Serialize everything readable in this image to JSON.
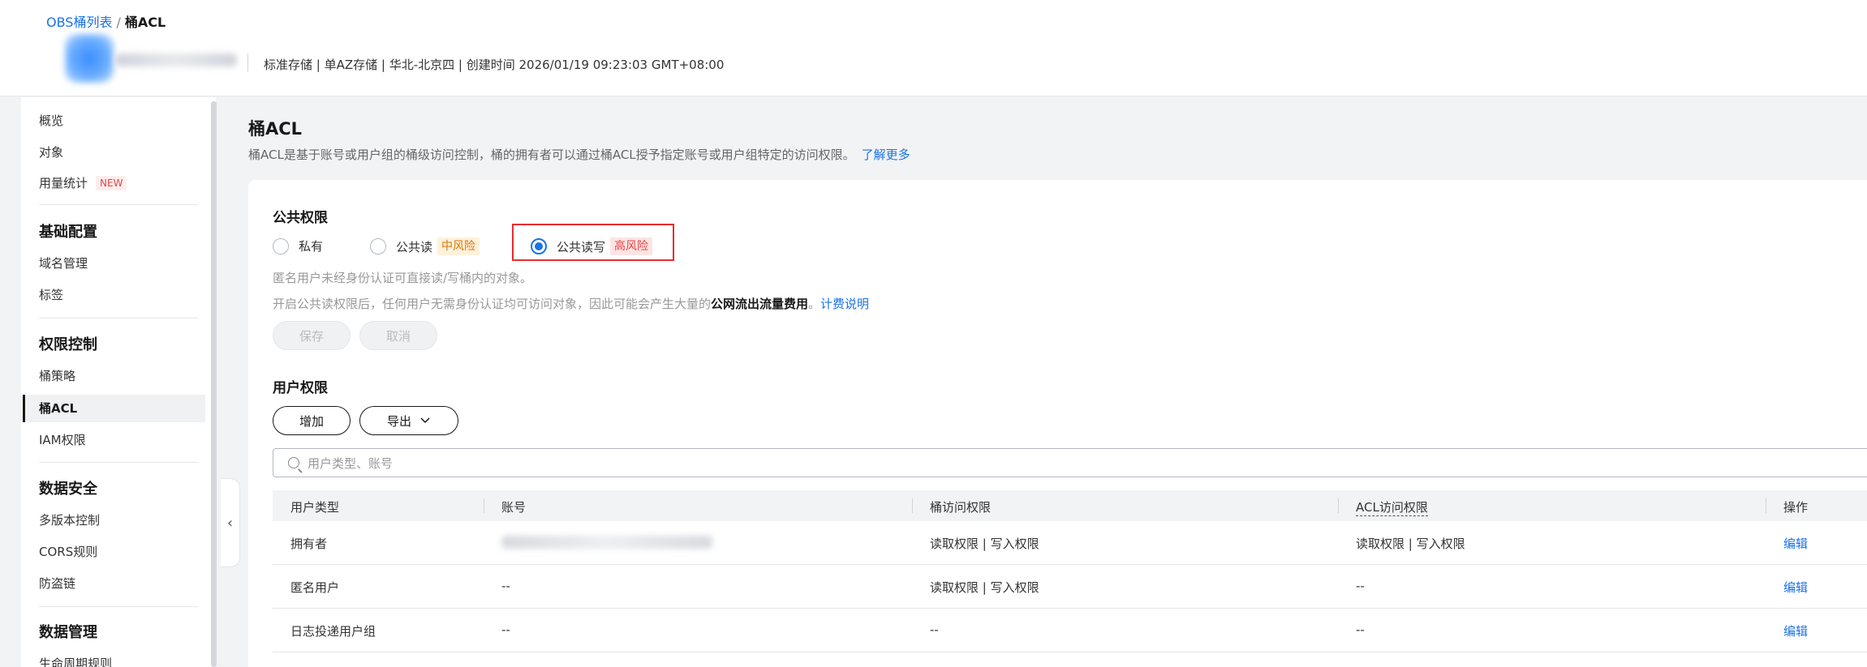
{
  "breadcrumb": {
    "parent": "OBS桶列表",
    "separator": "/",
    "current": "桶ACL"
  },
  "bucket": {
    "meta": "标准存储 | 单AZ存储 | 华北-北京四 | 创建时间 2026/01/19 09:23:03 GMT+08:00"
  },
  "sidebar": {
    "items": [
      {
        "label": "概览"
      },
      {
        "label": "对象"
      },
      {
        "label": "用量统计",
        "badge": "NEW"
      }
    ],
    "groups": [
      {
        "title": "基础配置",
        "items": [
          "域名管理",
          "标签"
        ]
      },
      {
        "title": "权限控制",
        "items": [
          "桶策略",
          "桶ACL",
          "IAM权限"
        ]
      },
      {
        "title": "数据安全",
        "items": [
          "多版本控制",
          "CORS规则",
          "防盗链"
        ]
      },
      {
        "title": "数据管理",
        "items": [
          "生命周期规则"
        ]
      }
    ],
    "active": "桶ACL",
    "collapse_icon": "‹"
  },
  "page": {
    "title": "桶ACL",
    "description": "桶ACL是基于账号或用户组的桶级访问控制，桶的拥有者可以通过桶ACL授予指定账号或用户组特定的访问权限。",
    "learn_more": "了解更多"
  },
  "public_permission": {
    "title": "公共权限",
    "options": [
      {
        "label": "私有",
        "risk": "",
        "checked": false
      },
      {
        "label": "公共读",
        "risk": "中风险",
        "checked": false
      },
      {
        "label": "公共读写",
        "risk": "高风险",
        "checked": true
      }
    ],
    "hint1": "匿名用户未经身份认证可直接读/写桶内的对象。",
    "hint2_prefix": "开启公共读权限后，任何用户无需身份认证均可访问对象，因此可能会产生大量的",
    "hint2_bold": "公网流出流量费用",
    "hint2_suffix": "。",
    "hint2_link": "计费说明",
    "save_label": "保存",
    "cancel_label": "取消"
  },
  "user_permission": {
    "title": "用户权限",
    "add_label": "增加",
    "export_label": "导出",
    "search_placeholder": "用户类型、账号",
    "columns": [
      "用户类型",
      "账号",
      "桶访问权限",
      "ACL访问权限",
      "操作"
    ],
    "rows": [
      {
        "user_type": "拥有者",
        "account": "",
        "bucket_access": "读取权限 | 写入权限",
        "acl_access": "读取权限 | 写入权限",
        "action": "编辑"
      },
      {
        "user_type": "匿名用户",
        "account": "--",
        "bucket_access": "读取权限 | 写入权限",
        "acl_access": "--",
        "action": "编辑"
      },
      {
        "user_type": "日志投递用户组",
        "account": "--",
        "bucket_access": "--",
        "acl_access": "--",
        "action": "编辑"
      }
    ]
  },
  "colors": {
    "accent": "#1a73e8",
    "danger": "#e62e2e",
    "warning": "#d97706"
  }
}
